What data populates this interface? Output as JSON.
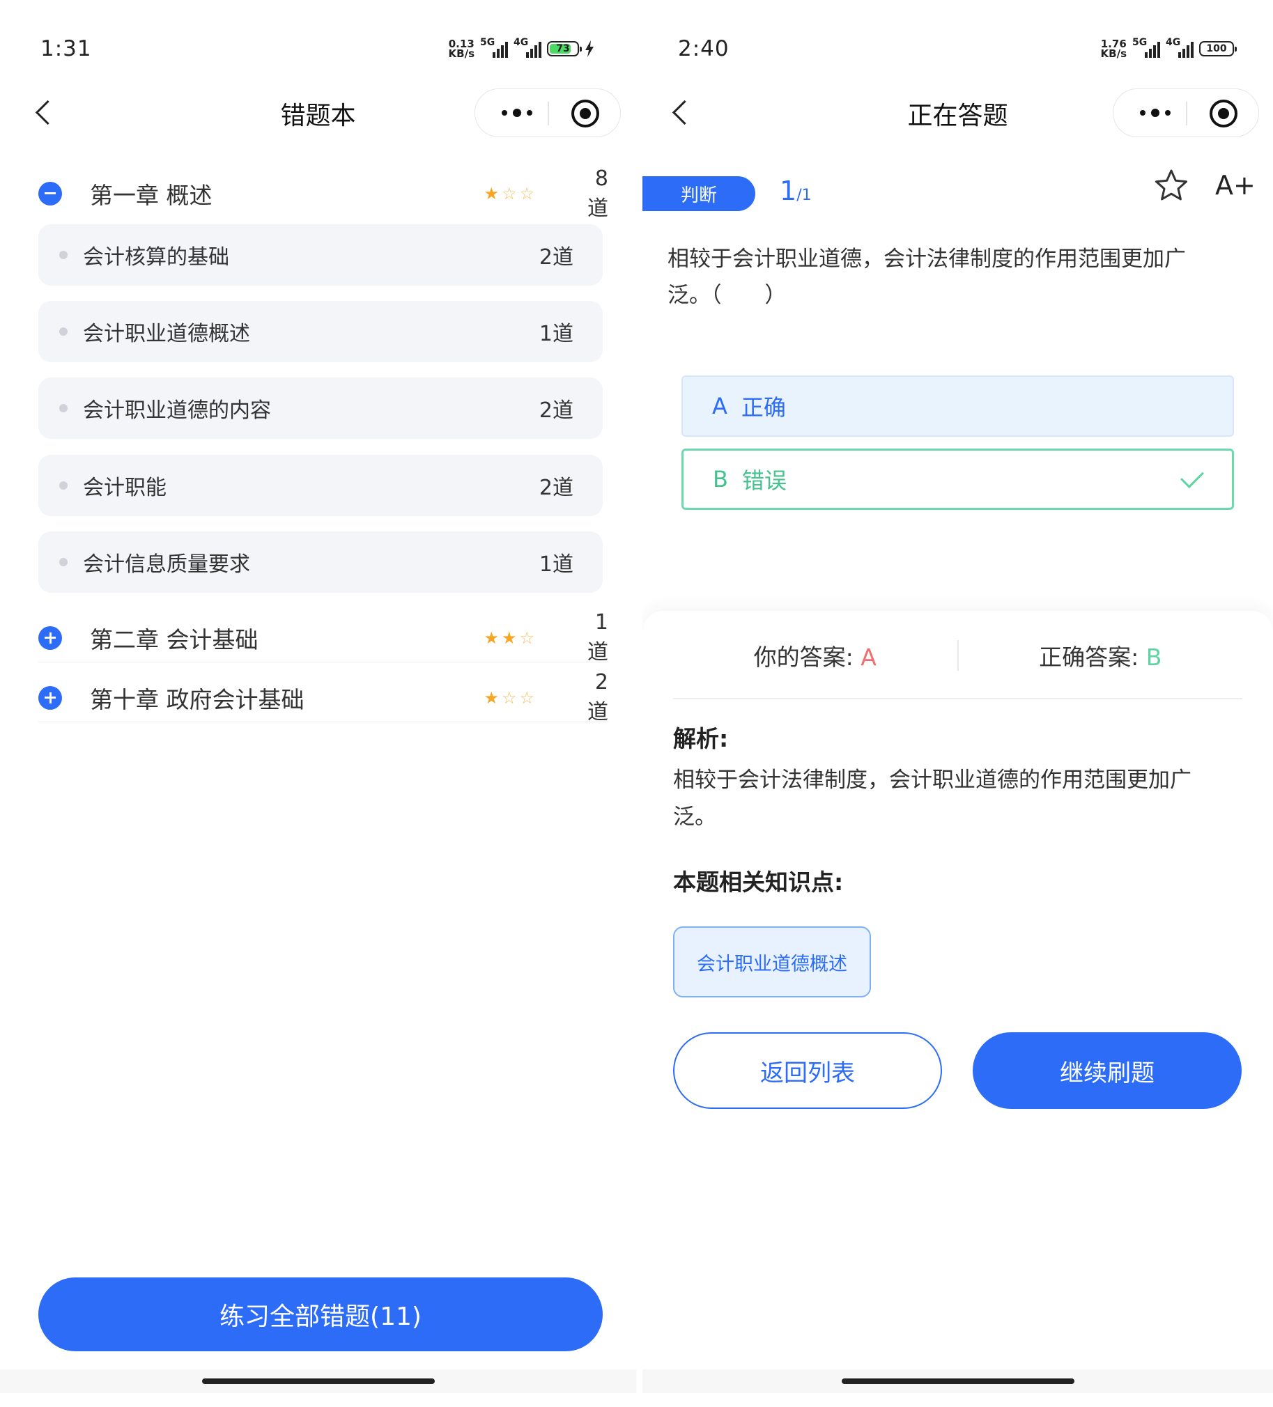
{
  "left": {
    "status": {
      "time": "1:31",
      "speed_top": "0.13",
      "speed_unit": "KB/s",
      "net1": "5G",
      "net2": "4G",
      "battery": "73"
    },
    "nav": {
      "title": "错题本"
    },
    "chapters": [
      {
        "title": "第一章 概述",
        "stars": [
          true,
          false,
          false
        ],
        "count": "8道",
        "expanded": true
      },
      {
        "title": "第二章 会计基础",
        "stars": [
          true,
          true,
          false
        ],
        "count": "1道",
        "expanded": false
      },
      {
        "title": "第十章 政府会计基础",
        "stars": [
          true,
          false,
          false
        ],
        "count": "2道",
        "expanded": false
      }
    ],
    "subitems": [
      {
        "label": "会计核算的基础",
        "count": "2道"
      },
      {
        "label": "会计职业道德概述",
        "count": "1道"
      },
      {
        "label": "会计职业道德的内容",
        "count": "2道"
      },
      {
        "label": "会计职能",
        "count": "2道"
      },
      {
        "label": "会计信息质量要求",
        "count": "1道"
      }
    ],
    "practice_button": "练习全部错题(11)"
  },
  "right": {
    "status": {
      "time": "2:40",
      "speed_top": "1.76",
      "speed_unit": "KB/s",
      "net1": "5G",
      "net2": "4G",
      "battery": "100"
    },
    "nav": {
      "title": "正在答题"
    },
    "tag": "判断",
    "progress": {
      "current": "1",
      "total": "/1"
    },
    "font_button": "A+",
    "question": "相较于会计职业道德，会计法律制度的作用范围更加广泛。（　　）",
    "options": [
      {
        "key": "A",
        "text": "正确"
      },
      {
        "key": "B",
        "text": "错误"
      }
    ],
    "your_answer_label": "你的答案:",
    "your_answer": "A",
    "correct_answer_label": "正确答案:",
    "correct_answer": "B",
    "analysis_title": "解析:",
    "analysis": "相较于会计法律制度，会计职业道德的作用范围更加广泛。",
    "knowledge_title": "本题相关知识点:",
    "knowledge_tag": "会计职业道德概述",
    "back_button": "返回列表",
    "continue_button": "继续刷题"
  },
  "colors": {
    "primary": "#2d6cf6",
    "correct": "#5fd3a3",
    "wrong": "#f26d6d",
    "star": "#f6a623"
  }
}
